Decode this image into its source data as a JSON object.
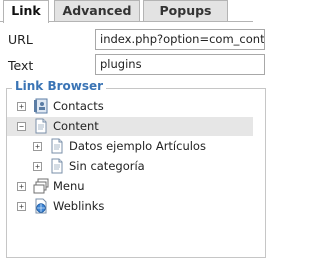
{
  "tabs": [
    {
      "label": "Link",
      "active": true
    },
    {
      "label": "Advanced",
      "active": false
    },
    {
      "label": "Popups",
      "active": false
    }
  ],
  "form": {
    "url_label": "URL",
    "url_value": "index.php?option=com_content",
    "text_label": "Text",
    "text_value": "plugins"
  },
  "link_browser": {
    "title": "Link Browser",
    "items": [
      {
        "label": "Contacts",
        "toggle": "+",
        "icon": "contacts-icon",
        "selected": false
      },
      {
        "label": "Content",
        "toggle": "−",
        "icon": "content-document-icon",
        "selected": true
      },
      {
        "label": "Datos ejemplo Artículos",
        "toggle": "+",
        "icon": "document-icon",
        "selected": false
      },
      {
        "label": "Sin categoría",
        "toggle": "+",
        "icon": "document-icon",
        "selected": false
      },
      {
        "label": "Menu",
        "toggle": "+",
        "icon": "menu-stack-icon",
        "selected": false
      },
      {
        "label": "Weblinks",
        "toggle": "+",
        "icon": "weblinks-globe-icon",
        "selected": false
      }
    ]
  },
  "colors": {
    "accent": "#3a74b5",
    "selected_row": "#e6e6e6",
    "tab_inactive": "#e3e3e3"
  }
}
